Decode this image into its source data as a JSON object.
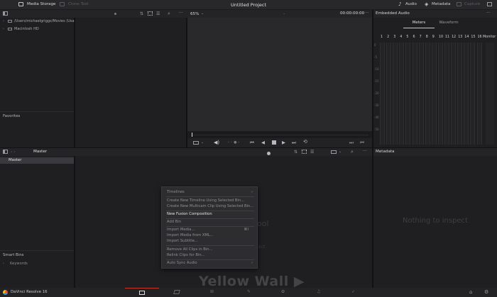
{
  "topbar": {
    "media_storage": "Media Storage",
    "clone_tool": "Clone Tool",
    "project_title": "Untitled Project",
    "audio": "Audio",
    "metadata": "Metadata",
    "capture": "Capture"
  },
  "storage": {
    "items": [
      "/Users/michaelgriggs/Movies (Usa",
      "Macintosh HD"
    ],
    "favorites": "Favorites"
  },
  "viewer": {
    "zoom": "65%",
    "timecode": "00:00:00:00"
  },
  "audio_panel": {
    "title": "Embedded Audio",
    "tabs": [
      "Meters",
      "Waveform"
    ],
    "channels": [
      "1",
      "2",
      "3",
      "4",
      "5",
      "6",
      "7",
      "8",
      "9",
      "10",
      "11",
      "12",
      "13",
      "14",
      "15",
      "16"
    ],
    "monitor": "Monitor",
    "scale": [
      "0",
      "-5",
      "-10",
      "-15",
      "-20",
      "-30",
      "-40",
      "-50"
    ]
  },
  "bins": {
    "title": "Master",
    "items": [
      "Master"
    ],
    "smart_bins": "Smart Bins",
    "keywords": "Keywords"
  },
  "media_pool": {
    "empty_text": "ool",
    "empty_sub": "ect"
  },
  "metadata_panel": {
    "title": "Metadata",
    "empty": "Nothing to inspect"
  },
  "context_menu": {
    "items": [
      "Timelines",
      "Create New Timeline Using Selected Bin...",
      "Create New Multicam Clip Using Selected Bin...",
      "New Fusion Composition",
      "Add Bin",
      "Import Media...",
      "Import Media from XML...",
      "Import Subtitle...",
      "Remove All Clips in Bin...",
      "Relink Clips for Bin...",
      "Auto Sync Audio"
    ],
    "import_shortcut": "⌘I"
  },
  "bottombar": {
    "app_name": "DaVinci Resolve 16"
  },
  "watermark": "Yellow Wall ▶",
  "colors": {
    "accent_red": "#c0392b",
    "bg": "#1c1c1e"
  }
}
